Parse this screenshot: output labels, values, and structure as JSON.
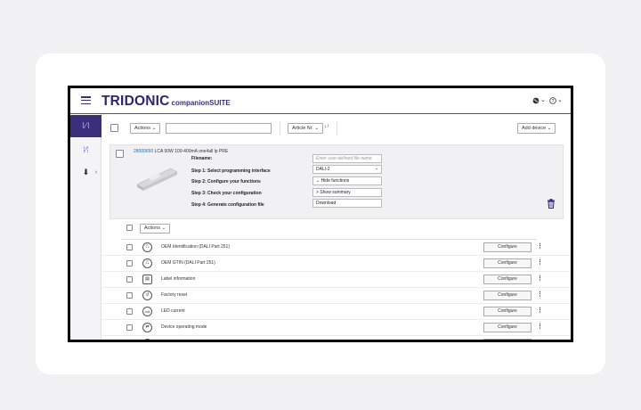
{
  "header": {
    "logo_main": "TRIDONIC",
    "logo_sub": "companionSUITE",
    "globe_icon": "globe-icon",
    "help_icon": "help-icon",
    "dropdown_glyph": "⌄"
  },
  "sidebar": {
    "items": [
      {
        "icon": "wave-icon",
        "glyph": "⌇⁄⌇",
        "active": true
      },
      {
        "icon": "wave-icon",
        "glyph": "⁞⁄⁞",
        "active": false
      },
      {
        "icon": "download-icon",
        "glyph": "⬇",
        "chevron": "›",
        "active": false
      }
    ]
  },
  "toolbar": {
    "actions_label": "Actions ⌄",
    "search_value": "",
    "sort_field_label": "Article Nr. ⌄",
    "sort_icon": "↓↑",
    "add_device_label": "Add device ⌄"
  },
  "device": {
    "article_number": "28000650",
    "name": " LCA 50W 100-400mA one4all lp PRE",
    "steps": [
      {
        "label": "Filename:"
      },
      {
        "label": "Step 1: Select programming interface"
      },
      {
        "label": "Step 2: Configure your functions"
      },
      {
        "label": "Step 3: Check your configuration"
      },
      {
        "label": "Step 4: Generate configuration file"
      }
    ],
    "filename_placeholder": "Enter user-defined file name",
    "interface_value": "DALI-2",
    "interface_chevron": "⌄",
    "hide_functions_label": "⌄   Hide functions",
    "show_summary_label": ">   Show summary",
    "download_label": "Download"
  },
  "functions": {
    "actions_label": "Actions ⌄",
    "configure_label": "Configure",
    "more_glyph": "⋮",
    "rows": [
      {
        "label": "OEM Identification (DALI Part 251)",
        "icon": "oem-id-icon",
        "glyph": "⎍"
      },
      {
        "label": "OEM GTIN (DALI Part 251)",
        "icon": "oem-gtin-icon",
        "glyph": "⎍"
      },
      {
        "label": "Label information",
        "icon": "label-icon",
        "glyph": "▤"
      },
      {
        "label": "Factory reset",
        "icon": "reset-icon",
        "glyph": "↺"
      },
      {
        "label": "LED current",
        "icon": "led-current-icon",
        "glyph": "mA"
      },
      {
        "label": "Device operating mode",
        "icon": "operating-mode-icon",
        "glyph": "⇄"
      },
      {
        "label": "",
        "icon": "function-icon",
        "glyph": "◌"
      }
    ]
  },
  "colors": {
    "brand": "#2e2470",
    "sidebar_active": "#3b2f7c",
    "link": "#1f6fb5",
    "delete": "#2e2470"
  }
}
